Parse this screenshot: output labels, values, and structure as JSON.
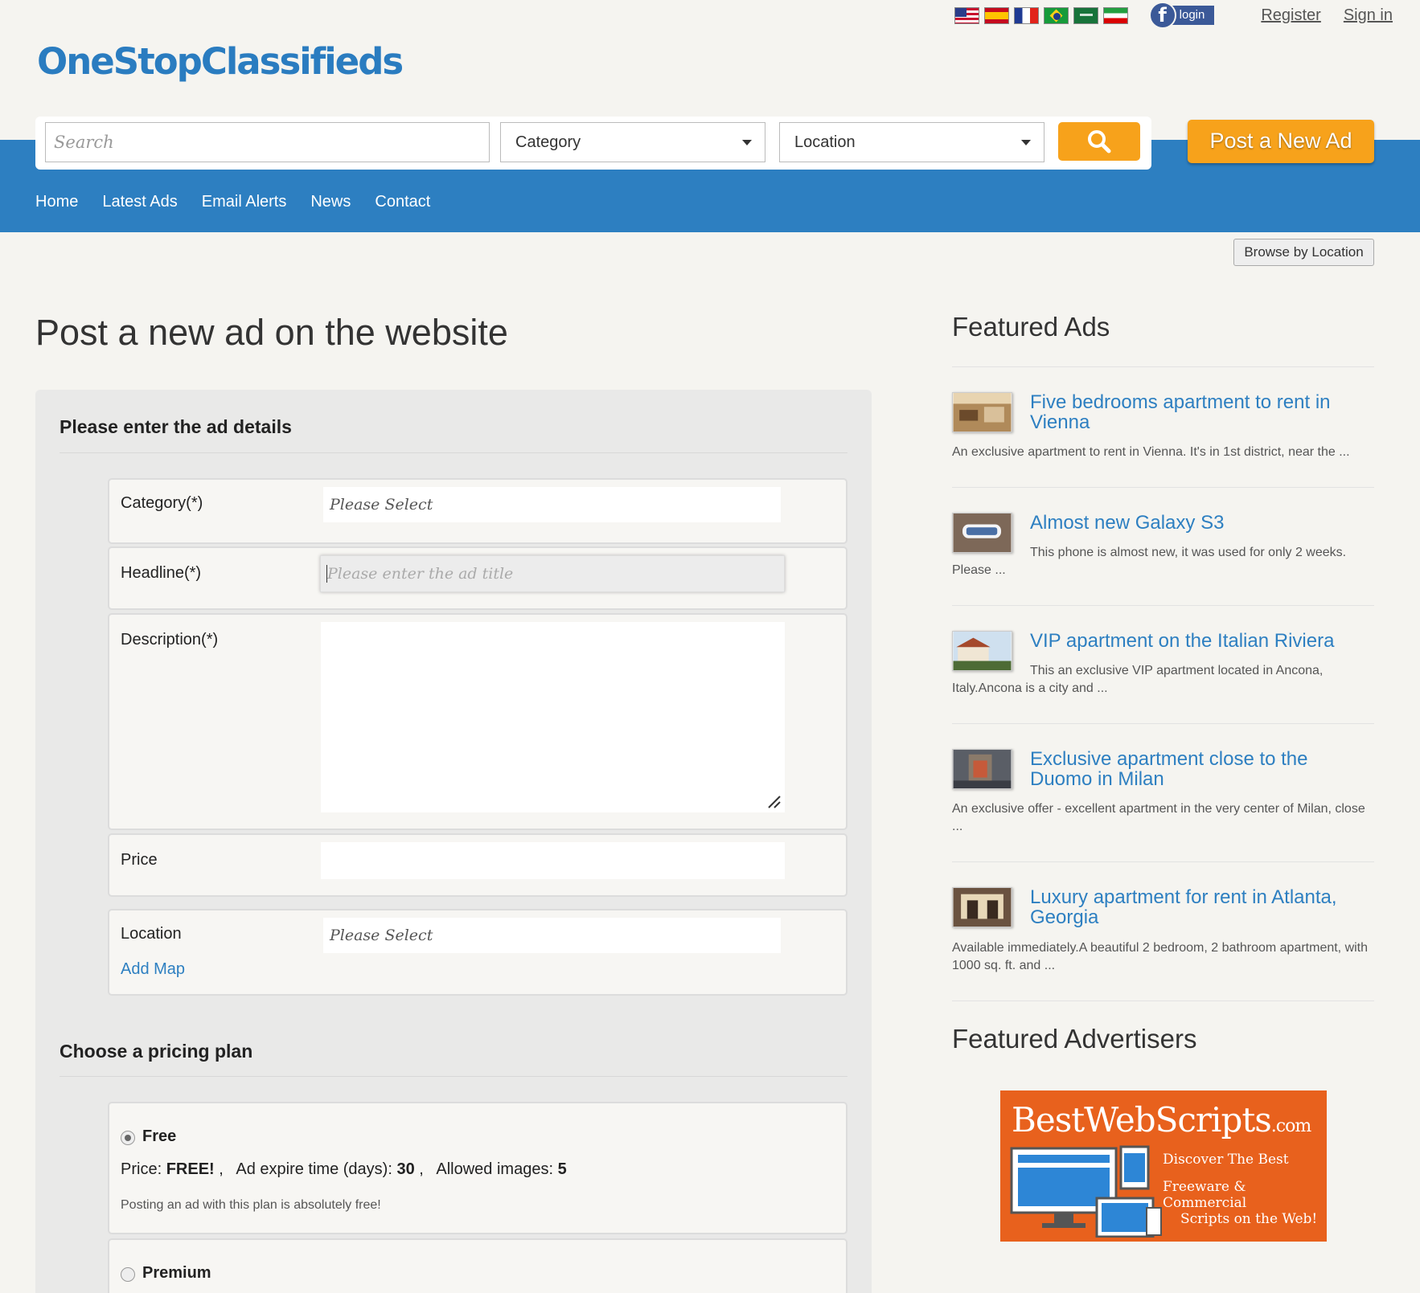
{
  "header": {
    "logo_text": "OneStopClassifieds",
    "flags": [
      "flag-us-icon",
      "flag-es-icon",
      "flag-fr-icon",
      "flag-br-icon",
      "flag-sa-icon",
      "flag-ir-icon"
    ],
    "facebook_icon": "f",
    "facebook_login": "login",
    "register": "Register",
    "sign_in": "Sign in"
  },
  "search": {
    "placeholder": "Search",
    "category_label": "Category",
    "location_label": "Location",
    "post_button": "Post a New Ad"
  },
  "nav": {
    "items": [
      "Home",
      "Latest Ads",
      "Email Alerts",
      "News",
      "Contact"
    ]
  },
  "browse_by_location": "Browse by Location",
  "main": {
    "title": "Post a new ad on the website",
    "details_heading": "Please enter the ad details",
    "fields": {
      "category_label": "Category(*)",
      "category_value": "Please Select",
      "headline_label": "Headline(*)",
      "headline_placeholder": "Please enter the ad title",
      "description_label": "Description(*)",
      "price_label": "Price",
      "location_label": "Location",
      "location_value": "Please Select",
      "add_map": "Add Map"
    },
    "pricing_heading": "Choose a pricing plan",
    "plans": [
      {
        "name": "Free",
        "price_label": "Price:",
        "price_value": "FREE!",
        "expire_label": "Ad expire time (days):",
        "expire_value": "30",
        "images_label": "Allowed images:",
        "images_value": "5",
        "description": "Posting an ad with this plan is absolutely free!",
        "selected": true
      },
      {
        "name": "Premium",
        "selected": false
      }
    ]
  },
  "sidebar": {
    "featured_ads_heading": "Featured Ads",
    "ads": [
      {
        "title": "Five bedrooms apartment to rent in Vienna",
        "description": "An exclusive apartment to rent in Vienna. It's in 1st district, near the ..."
      },
      {
        "title": "Almost new Galaxy S3",
        "description": "This phone is almost new, it was used for only 2 weeks.",
        "description_cont": "Please ..."
      },
      {
        "title": "VIP apartment on the Italian Riviera",
        "description": "This an exclusive VIP apartment located in Ancona,",
        "description_cont": "Italy.Ancona is a city and ..."
      },
      {
        "title": "Exclusive apartment close to the Duomo in Milan",
        "description": "An exclusive offer - excellent apartment in the very center of Milan, close ..."
      },
      {
        "title": "Luxury apartment for rent in Atlanta, Georgia",
        "description": "Available immediately.A beautiful 2 bedroom, 2 bathroom apartment, with 1000 sq. ft. and ..."
      }
    ],
    "featured_advertisers_heading": "Featured Advertisers",
    "banner": {
      "brand": "BestWebScripts",
      "domain": ".com",
      "line1": "Discover The Best",
      "line2": "Freeware & Commercial",
      "line3": "Scripts on the Web!"
    }
  },
  "colors": {
    "brand_blue": "#2d7fc1",
    "accent_orange": "#f7a21b",
    "banner_orange": "#e8611d"
  }
}
